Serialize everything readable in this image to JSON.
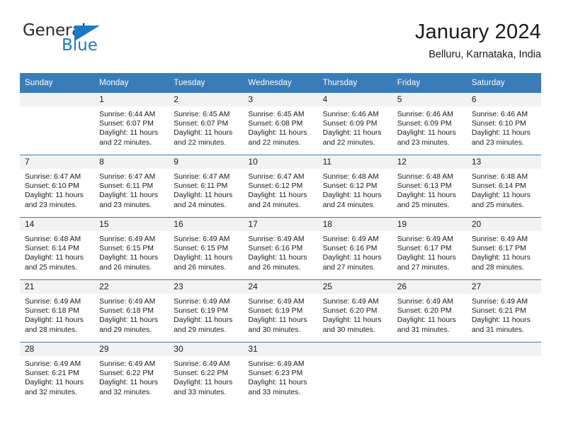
{
  "brand": {
    "name_top": "General",
    "name_bottom": "Blue",
    "triangle_icon": "triangle-icon",
    "color_blue": "#1b7ac4",
    "color_dark": "#2b2b2b"
  },
  "header": {
    "title": "January 2024",
    "subtitle": "Belluru, Karnataka, India"
  },
  "theme": {
    "header_bg": "#3a7cba",
    "header_text": "#ffffff",
    "daynum_bg": "#f2f2f2",
    "cell_bg": "#ffffff",
    "grid_line": "#3a7cba"
  },
  "weekday_headers": [
    "Sunday",
    "Monday",
    "Tuesday",
    "Wednesday",
    "Thursday",
    "Friday",
    "Saturday"
  ],
  "weeks": [
    {
      "days": [
        {
          "num": "",
          "sunrise": "",
          "sunset": "",
          "daylight_line1": "",
          "daylight_line2": "",
          "empty": true
        },
        {
          "num": "1",
          "sunrise": "Sunrise: 6:44 AM",
          "sunset": "Sunset: 6:07 PM",
          "daylight_line1": "Daylight: 11 hours",
          "daylight_line2": "and 22 minutes.",
          "empty": false
        },
        {
          "num": "2",
          "sunrise": "Sunrise: 6:45 AM",
          "sunset": "Sunset: 6:07 PM",
          "daylight_line1": "Daylight: 11 hours",
          "daylight_line2": "and 22 minutes.",
          "empty": false
        },
        {
          "num": "3",
          "sunrise": "Sunrise: 6:45 AM",
          "sunset": "Sunset: 6:08 PM",
          "daylight_line1": "Daylight: 11 hours",
          "daylight_line2": "and 22 minutes.",
          "empty": false
        },
        {
          "num": "4",
          "sunrise": "Sunrise: 6:46 AM",
          "sunset": "Sunset: 6:09 PM",
          "daylight_line1": "Daylight: 11 hours",
          "daylight_line2": "and 22 minutes.",
          "empty": false
        },
        {
          "num": "5",
          "sunrise": "Sunrise: 6:46 AM",
          "sunset": "Sunset: 6:09 PM",
          "daylight_line1": "Daylight: 11 hours",
          "daylight_line2": "and 23 minutes.",
          "empty": false
        },
        {
          "num": "6",
          "sunrise": "Sunrise: 6:46 AM",
          "sunset": "Sunset: 6:10 PM",
          "daylight_line1": "Daylight: 11 hours",
          "daylight_line2": "and 23 minutes.",
          "empty": false
        }
      ]
    },
    {
      "days": [
        {
          "num": "7",
          "sunrise": "Sunrise: 6:47 AM",
          "sunset": "Sunset: 6:10 PM",
          "daylight_line1": "Daylight: 11 hours",
          "daylight_line2": "and 23 minutes.",
          "empty": false
        },
        {
          "num": "8",
          "sunrise": "Sunrise: 6:47 AM",
          "sunset": "Sunset: 6:11 PM",
          "daylight_line1": "Daylight: 11 hours",
          "daylight_line2": "and 23 minutes.",
          "empty": false
        },
        {
          "num": "9",
          "sunrise": "Sunrise: 6:47 AM",
          "sunset": "Sunset: 6:11 PM",
          "daylight_line1": "Daylight: 11 hours",
          "daylight_line2": "and 24 minutes.",
          "empty": false
        },
        {
          "num": "10",
          "sunrise": "Sunrise: 6:47 AM",
          "sunset": "Sunset: 6:12 PM",
          "daylight_line1": "Daylight: 11 hours",
          "daylight_line2": "and 24 minutes.",
          "empty": false
        },
        {
          "num": "11",
          "sunrise": "Sunrise: 6:48 AM",
          "sunset": "Sunset: 6:12 PM",
          "daylight_line1": "Daylight: 11 hours",
          "daylight_line2": "and 24 minutes.",
          "empty": false
        },
        {
          "num": "12",
          "sunrise": "Sunrise: 6:48 AM",
          "sunset": "Sunset: 6:13 PM",
          "daylight_line1": "Daylight: 11 hours",
          "daylight_line2": "and 25 minutes.",
          "empty": false
        },
        {
          "num": "13",
          "sunrise": "Sunrise: 6:48 AM",
          "sunset": "Sunset: 6:14 PM",
          "daylight_line1": "Daylight: 11 hours",
          "daylight_line2": "and 25 minutes.",
          "empty": false
        }
      ]
    },
    {
      "days": [
        {
          "num": "14",
          "sunrise": "Sunrise: 6:48 AM",
          "sunset": "Sunset: 6:14 PM",
          "daylight_line1": "Daylight: 11 hours",
          "daylight_line2": "and 25 minutes.",
          "empty": false
        },
        {
          "num": "15",
          "sunrise": "Sunrise: 6:49 AM",
          "sunset": "Sunset: 6:15 PM",
          "daylight_line1": "Daylight: 11 hours",
          "daylight_line2": "and 26 minutes.",
          "empty": false
        },
        {
          "num": "16",
          "sunrise": "Sunrise: 6:49 AM",
          "sunset": "Sunset: 6:15 PM",
          "daylight_line1": "Daylight: 11 hours",
          "daylight_line2": "and 26 minutes.",
          "empty": false
        },
        {
          "num": "17",
          "sunrise": "Sunrise: 6:49 AM",
          "sunset": "Sunset: 6:16 PM",
          "daylight_line1": "Daylight: 11 hours",
          "daylight_line2": "and 26 minutes.",
          "empty": false
        },
        {
          "num": "18",
          "sunrise": "Sunrise: 6:49 AM",
          "sunset": "Sunset: 6:16 PM",
          "daylight_line1": "Daylight: 11 hours",
          "daylight_line2": "and 27 minutes.",
          "empty": false
        },
        {
          "num": "19",
          "sunrise": "Sunrise: 6:49 AM",
          "sunset": "Sunset: 6:17 PM",
          "daylight_line1": "Daylight: 11 hours",
          "daylight_line2": "and 27 minutes.",
          "empty": false
        },
        {
          "num": "20",
          "sunrise": "Sunrise: 6:49 AM",
          "sunset": "Sunset: 6:17 PM",
          "daylight_line1": "Daylight: 11 hours",
          "daylight_line2": "and 28 minutes.",
          "empty": false
        }
      ]
    },
    {
      "days": [
        {
          "num": "21",
          "sunrise": "Sunrise: 6:49 AM",
          "sunset": "Sunset: 6:18 PM",
          "daylight_line1": "Daylight: 11 hours",
          "daylight_line2": "and 28 minutes.",
          "empty": false
        },
        {
          "num": "22",
          "sunrise": "Sunrise: 6:49 AM",
          "sunset": "Sunset: 6:18 PM",
          "daylight_line1": "Daylight: 11 hours",
          "daylight_line2": "and 29 minutes.",
          "empty": false
        },
        {
          "num": "23",
          "sunrise": "Sunrise: 6:49 AM",
          "sunset": "Sunset: 6:19 PM",
          "daylight_line1": "Daylight: 11 hours",
          "daylight_line2": "and 29 minutes.",
          "empty": false
        },
        {
          "num": "24",
          "sunrise": "Sunrise: 6:49 AM",
          "sunset": "Sunset: 6:19 PM",
          "daylight_line1": "Daylight: 11 hours",
          "daylight_line2": "and 30 minutes.",
          "empty": false
        },
        {
          "num": "25",
          "sunrise": "Sunrise: 6:49 AM",
          "sunset": "Sunset: 6:20 PM",
          "daylight_line1": "Daylight: 11 hours",
          "daylight_line2": "and 30 minutes.",
          "empty": false
        },
        {
          "num": "26",
          "sunrise": "Sunrise: 6:49 AM",
          "sunset": "Sunset: 6:20 PM",
          "daylight_line1": "Daylight: 11 hours",
          "daylight_line2": "and 31 minutes.",
          "empty": false
        },
        {
          "num": "27",
          "sunrise": "Sunrise: 6:49 AM",
          "sunset": "Sunset: 6:21 PM",
          "daylight_line1": "Daylight: 11 hours",
          "daylight_line2": "and 31 minutes.",
          "empty": false
        }
      ]
    },
    {
      "days": [
        {
          "num": "28",
          "sunrise": "Sunrise: 6:49 AM",
          "sunset": "Sunset: 6:21 PM",
          "daylight_line1": "Daylight: 11 hours",
          "daylight_line2": "and 32 minutes.",
          "empty": false
        },
        {
          "num": "29",
          "sunrise": "Sunrise: 6:49 AM",
          "sunset": "Sunset: 6:22 PM",
          "daylight_line1": "Daylight: 11 hours",
          "daylight_line2": "and 32 minutes.",
          "empty": false
        },
        {
          "num": "30",
          "sunrise": "Sunrise: 6:49 AM",
          "sunset": "Sunset: 6:22 PM",
          "daylight_line1": "Daylight: 11 hours",
          "daylight_line2": "and 33 minutes.",
          "empty": false
        },
        {
          "num": "31",
          "sunrise": "Sunrise: 6:49 AM",
          "sunset": "Sunset: 6:23 PM",
          "daylight_line1": "Daylight: 11 hours",
          "daylight_line2": "and 33 minutes.",
          "empty": false
        },
        {
          "num": "",
          "sunrise": "",
          "sunset": "",
          "daylight_line1": "",
          "daylight_line2": "",
          "empty": true
        },
        {
          "num": "",
          "sunrise": "",
          "sunset": "",
          "daylight_line1": "",
          "daylight_line2": "",
          "empty": true
        },
        {
          "num": "",
          "sunrise": "",
          "sunset": "",
          "daylight_line1": "",
          "daylight_line2": "",
          "empty": true
        }
      ]
    }
  ]
}
